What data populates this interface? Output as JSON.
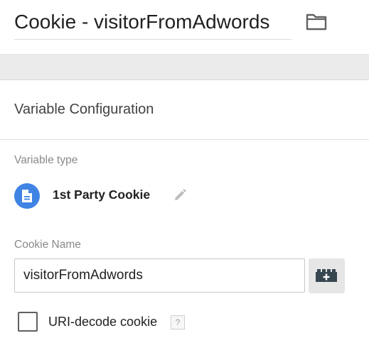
{
  "header": {
    "title": "Cookie - visitorFromAdwords",
    "folder_icon": "folder-icon"
  },
  "config": {
    "section_title": "Variable Configuration",
    "variable_type_label": "Variable type",
    "variable_type_name": "1st Party Cookie",
    "variable_type_icon": "document-icon",
    "accent_color": "#3f83e4",
    "edit_icon": "pencil-icon",
    "cookie_name_label": "Cookie Name",
    "cookie_name_value": "visitorFromAdwords",
    "insert_variable_icon": "lego-brick-plus-icon",
    "uri_decode_label": "URI-decode cookie",
    "uri_decode_checked": false,
    "help_glyph": "?"
  }
}
